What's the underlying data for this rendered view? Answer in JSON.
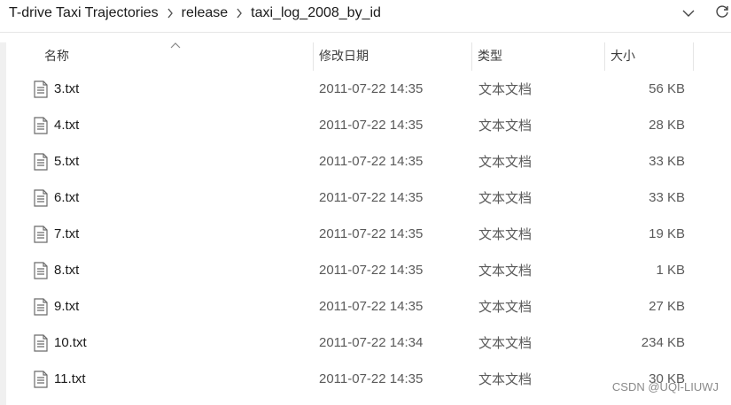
{
  "breadcrumb": [
    "T-drive Taxi Trajectories",
    "release",
    "taxi_log_2008_by_id"
  ],
  "columns": {
    "name": "名称",
    "date": "修改日期",
    "type": "类型",
    "size": "大小"
  },
  "files": [
    {
      "name": "3.txt",
      "date": "2011-07-22 14:35",
      "type": "文本文档",
      "size": "56 KB"
    },
    {
      "name": "4.txt",
      "date": "2011-07-22 14:35",
      "type": "文本文档",
      "size": "28 KB"
    },
    {
      "name": "5.txt",
      "date": "2011-07-22 14:35",
      "type": "文本文档",
      "size": "33 KB"
    },
    {
      "name": "6.txt",
      "date": "2011-07-22 14:35",
      "type": "文本文档",
      "size": "33 KB"
    },
    {
      "name": "7.txt",
      "date": "2011-07-22 14:35",
      "type": "文本文档",
      "size": "19 KB"
    },
    {
      "name": "8.txt",
      "date": "2011-07-22 14:35",
      "type": "文本文档",
      "size": "1 KB"
    },
    {
      "name": "9.txt",
      "date": "2011-07-22 14:35",
      "type": "文本文档",
      "size": "27 KB"
    },
    {
      "name": "10.txt",
      "date": "2011-07-22 14:34",
      "type": "文本文档",
      "size": "234 KB"
    },
    {
      "name": "11.txt",
      "date": "2011-07-22 14:35",
      "type": "文本文档",
      "size": "30 KB"
    }
  ],
  "watermark": "CSDN @UQI-LIUWJ",
  "icons": {
    "separator": "chevron-right-icon",
    "dropdown": "chevron-down-icon",
    "refresh": "refresh-icon",
    "file": "text-file-icon",
    "sort": "sort-ascending-icon"
  }
}
